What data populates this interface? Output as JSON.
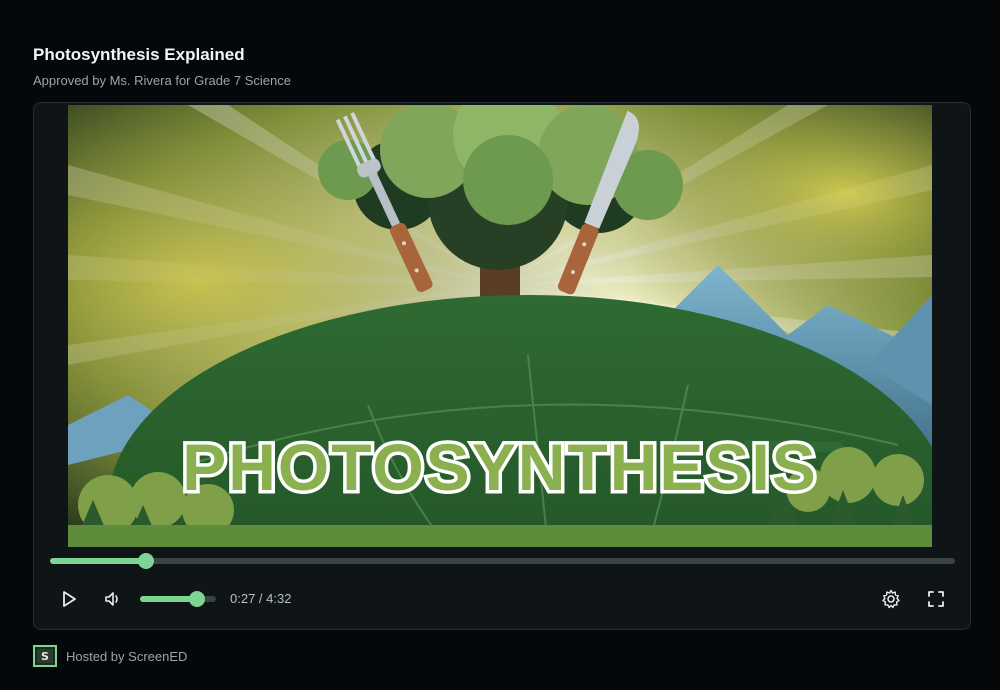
{
  "header": {
    "title": "Photosynthesis Explained",
    "subtitle": "Approved by Ms. Rivera for Grade 7 Science"
  },
  "video": {
    "overlay_text": "PHOTOSYNTHESIS"
  },
  "player": {
    "progress_fraction": 0.106,
    "volume_fraction": 0.75,
    "time_display": "0:27 / 4:32",
    "icons": {
      "play": "play-icon",
      "volume": "volume-icon",
      "settings": "gear-icon",
      "fullscreen": "fullscreen-icon"
    },
    "accent_color": "#7ed492"
  },
  "footer": {
    "logo_letter": "S",
    "hosted_text": "Hosted by ScreenED"
  }
}
